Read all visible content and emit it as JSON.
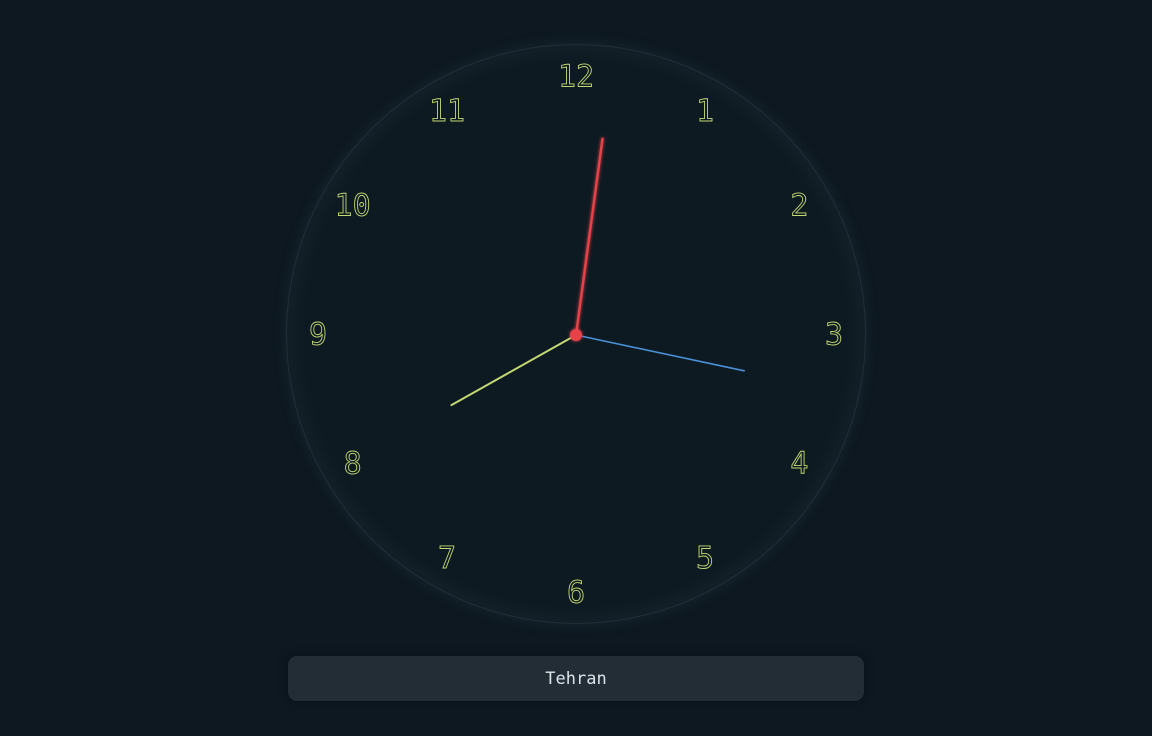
{
  "clock": {
    "numerals": [
      "12",
      "1",
      "2",
      "3",
      "4",
      "5",
      "6",
      "7",
      "8",
      "9",
      "10",
      "11"
    ],
    "time": {
      "hour": 8,
      "minute": 1,
      "second": 17
    },
    "colors": {
      "numerals": "#c3d872",
      "hour_hand": "#c3d872",
      "minute_hand": "#e8424a",
      "second_hand": "#4a90d6",
      "center_cap": "#e8424a"
    }
  },
  "city_button": {
    "label": "Tehran"
  }
}
